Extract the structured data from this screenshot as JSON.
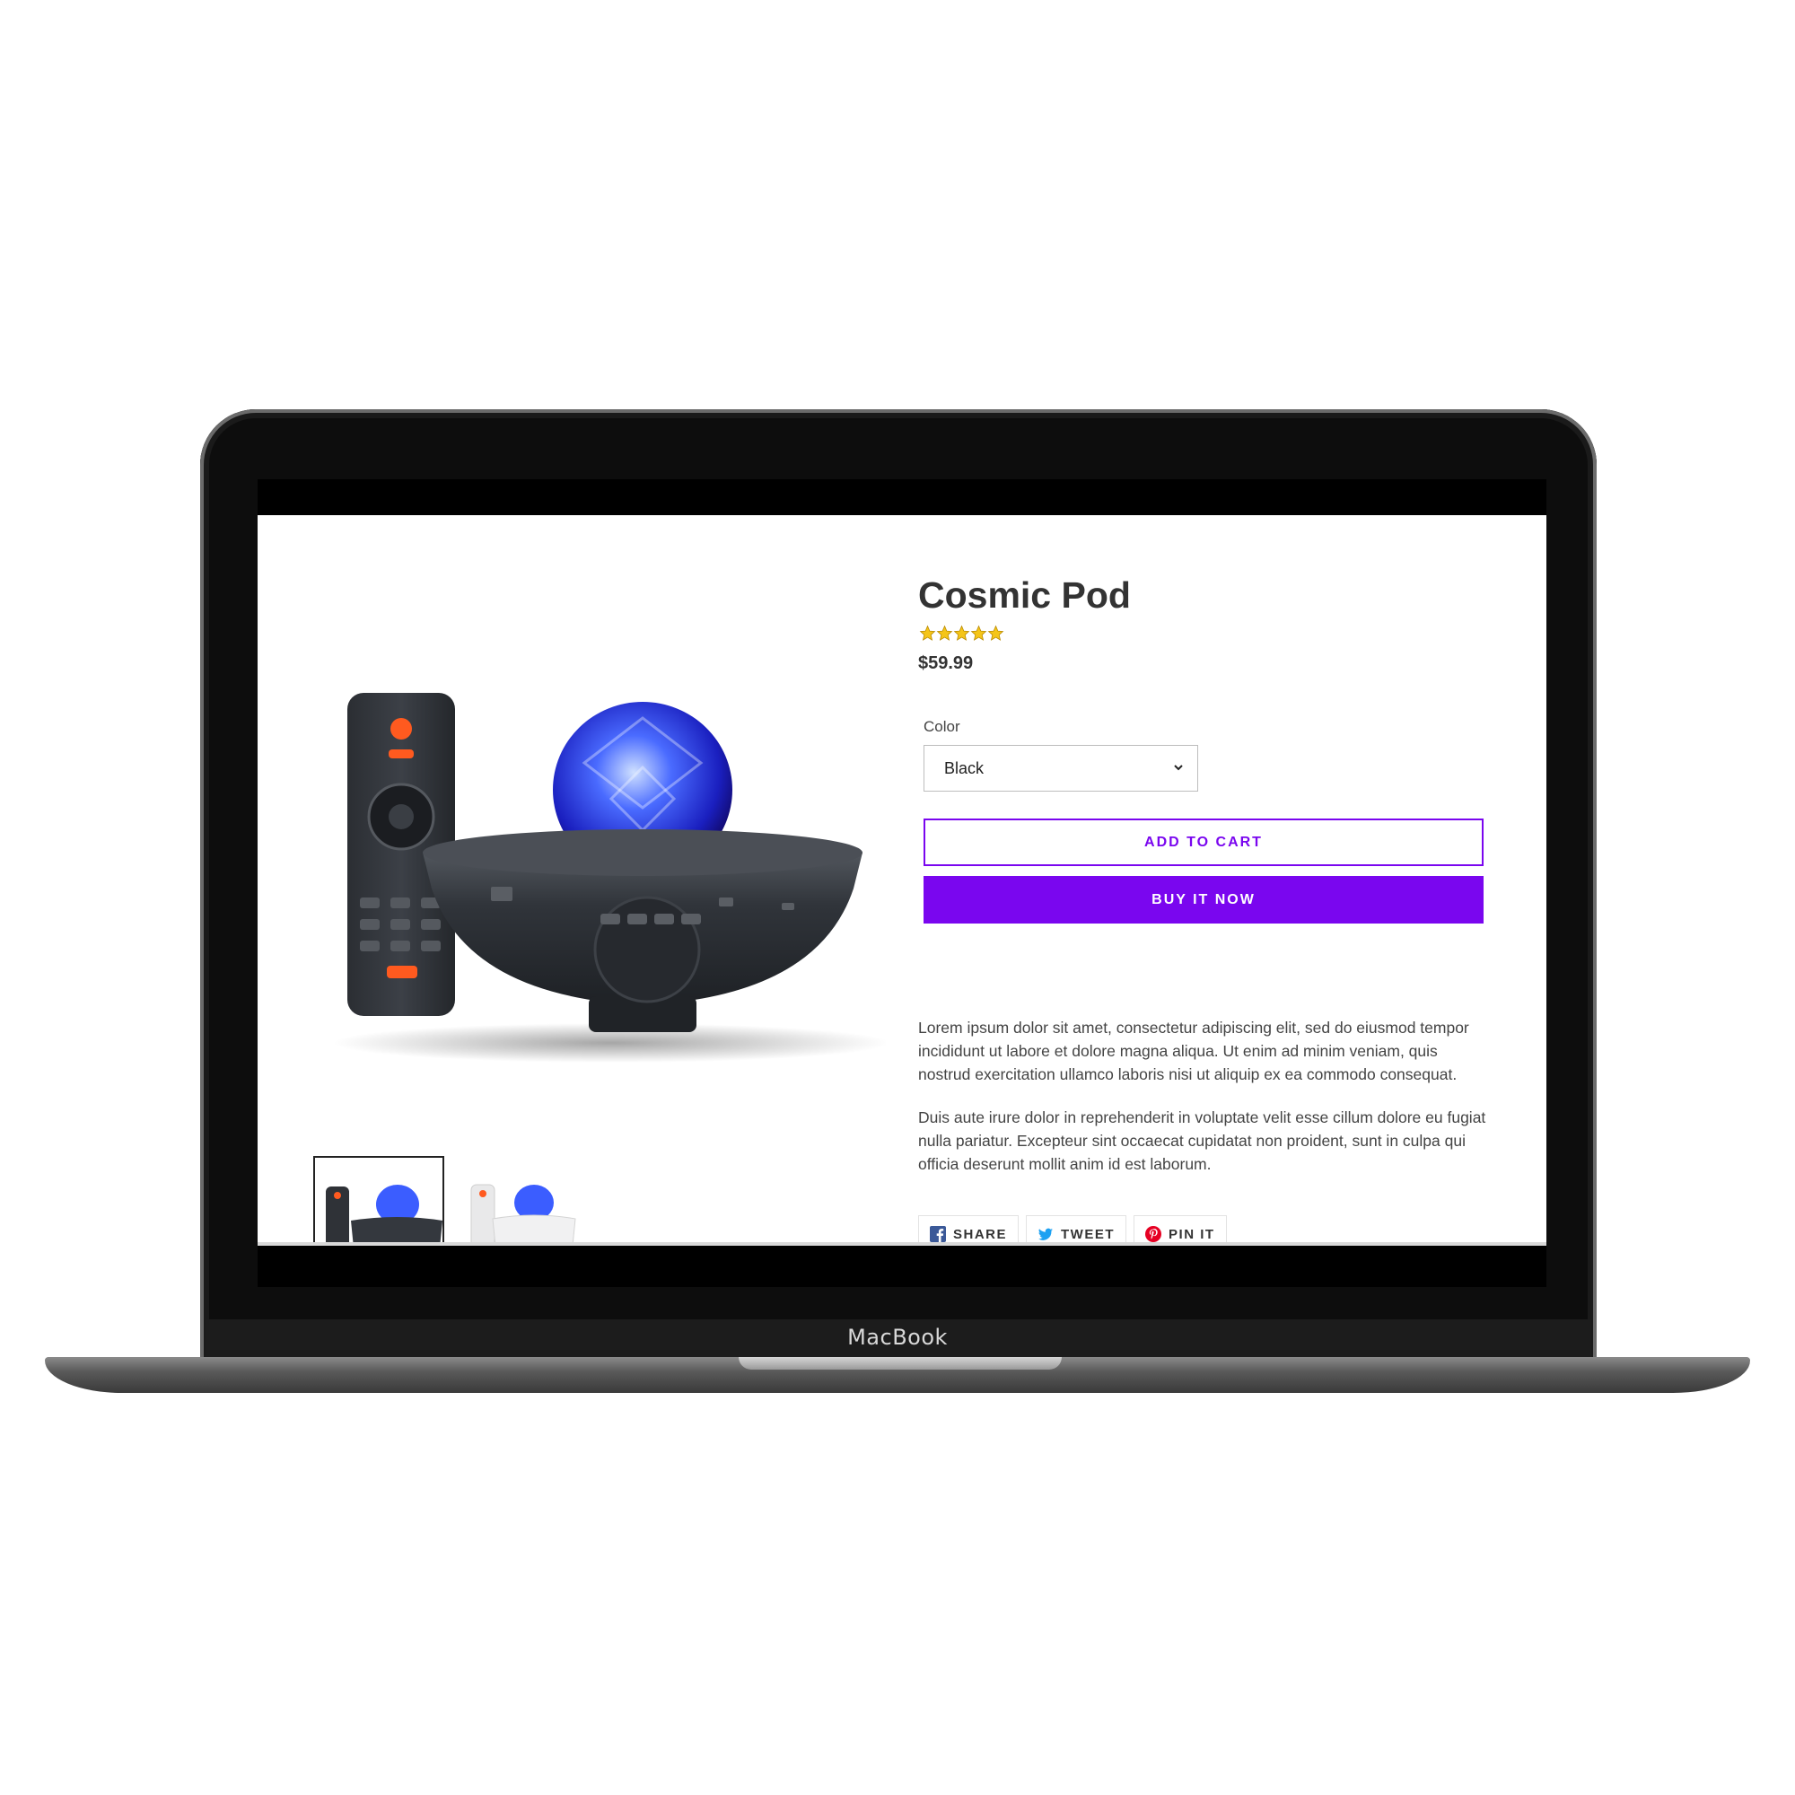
{
  "device": {
    "brand": "MacBook"
  },
  "product": {
    "title": "Cosmic Pod",
    "rating": 5,
    "rating_max": 5,
    "price": "$59.99",
    "color_label": "Color",
    "color_selected": "Black",
    "add_to_cart": "ADD TO CART",
    "buy_now": "BUY IT NOW",
    "description": [
      "Lorem ipsum dolor sit amet, consectetur adipiscing elit, sed do eiusmod tempor incididunt ut labore et dolore magna aliqua. Ut enim ad minim veniam, quis nostrud exercitation ullamco laboris nisi ut aliquip ex ea commodo consequat.",
      "Duis aute irure dolor in reprehenderit in voluptate velit esse cillum dolore eu fugiat nulla pariatur. Excepteur sint occaecat cupidatat non proident, sunt in culpa qui officia deserunt mollit anim id est laborum."
    ]
  },
  "share": {
    "facebook": "SHARE",
    "twitter": "TWEET",
    "pinterest": "PIN IT"
  },
  "colors": {
    "accent": "#7a06ef",
    "star": "#f5c518"
  }
}
